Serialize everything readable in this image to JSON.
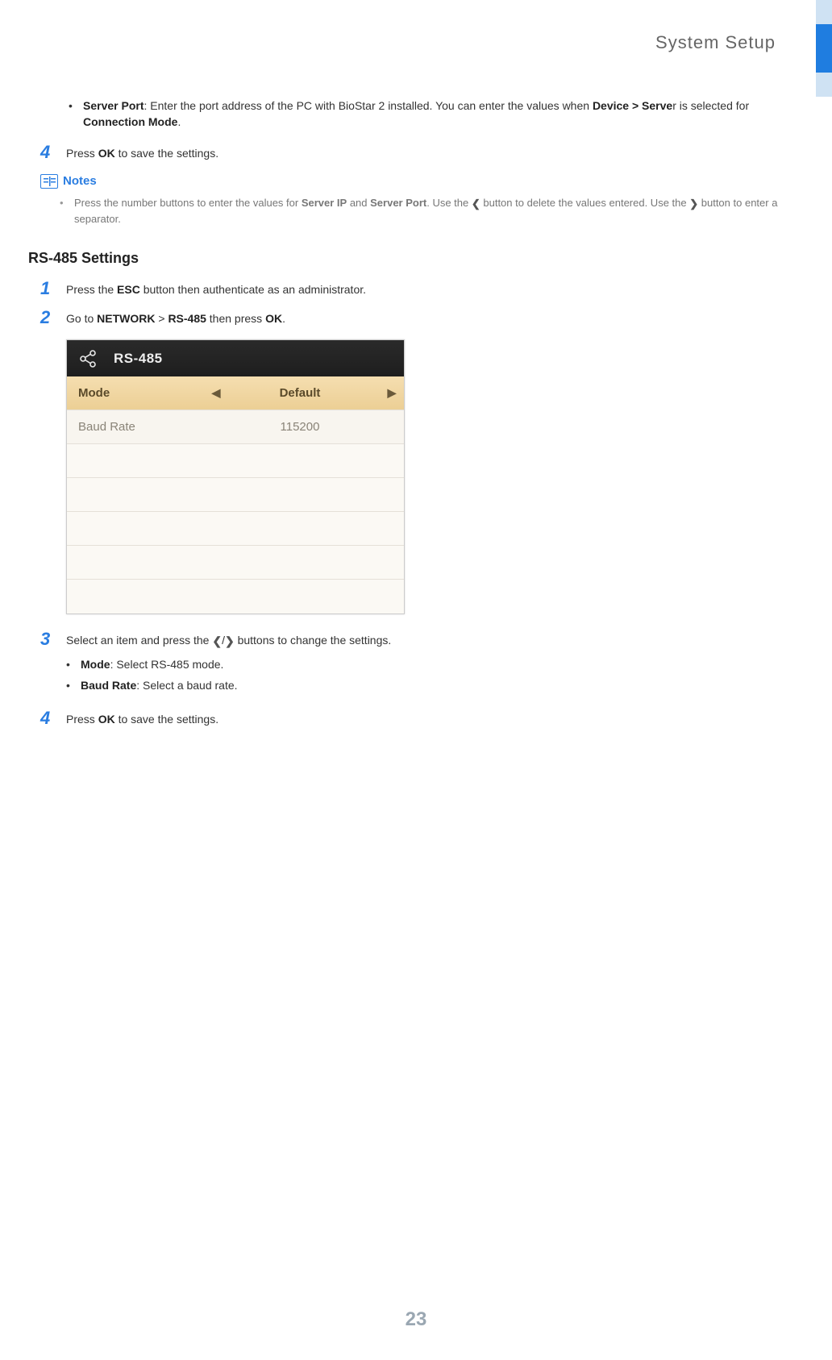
{
  "header": {
    "title": "System Setup"
  },
  "intro_bullet": {
    "label": "Server Port",
    "text": ": Enter the port address of the PC with BioStar 2 installed. You can enter the values when ",
    "bold2": "Device > Serve",
    "text2": "r is selected for ",
    "bold3": "Connection Mode",
    "text3": "."
  },
  "step4a": {
    "num": "4",
    "pre": "Press ",
    "bold": "OK",
    "post": " to save the settings."
  },
  "notes": {
    "title": "Notes",
    "item": {
      "pre": "Press the number buttons to enter the values for ",
      "b1": "Server IP",
      "mid1": " and ",
      "b2": "Server Port",
      "mid2": ". Use the ",
      "chevL": "❮",
      "mid3": " button to delete the values entered. Use the ",
      "chevR": "❯",
      "post": " button to enter a separator."
    }
  },
  "section_title": "RS-485 Settings",
  "step1": {
    "num": "1",
    "pre": "Press the ",
    "bold": "ESC",
    "post": " button then authenticate as an administrator."
  },
  "step2": {
    "num": "2",
    "t1": "Go to ",
    "b1": "NETWORK",
    "t2": " > ",
    "b2": "RS-485",
    "t3": " then press ",
    "b3": "OK",
    "t4": "."
  },
  "screenshot": {
    "title": "RS-485",
    "row1": {
      "label": "Mode",
      "arrowL": "◀",
      "value": "Default",
      "arrowR": "▶"
    },
    "row2": {
      "label": "Baud Rate",
      "value": "115200"
    }
  },
  "step3": {
    "num": "3",
    "pre": "Select an item and press the ",
    "chevL": "❮",
    "slash": "/",
    "chevR": "❯",
    "post": " buttons to change the settings.",
    "bullets": [
      {
        "label": "Mode",
        "text": ": Select RS-485 mode."
      },
      {
        "label": "Baud Rate",
        "text": ": Select a baud rate."
      }
    ]
  },
  "step4b": {
    "num": "4",
    "pre": "Press ",
    "bold": "OK",
    "post": " to save the settings."
  },
  "page_number": "23"
}
